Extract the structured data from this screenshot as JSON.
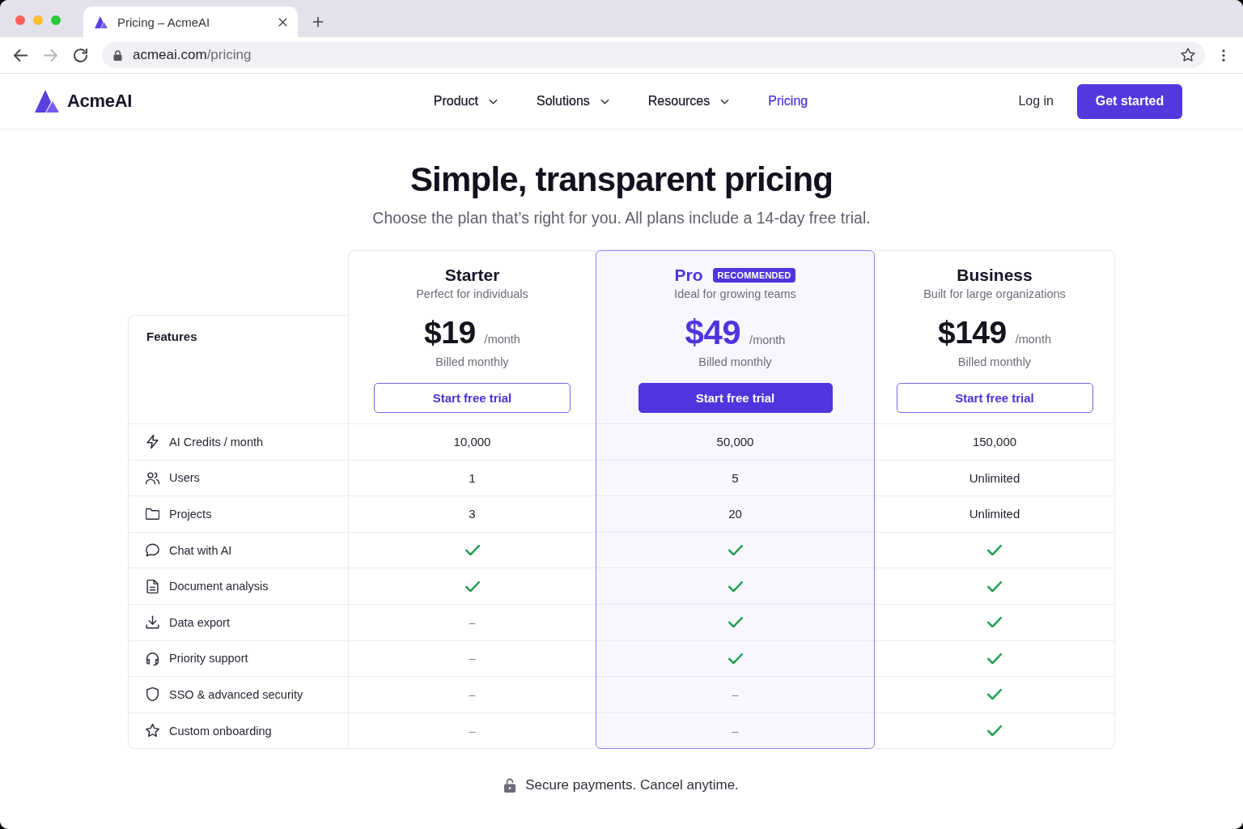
{
  "browser": {
    "tabs": [
      {
        "title": "Pricing – AcmeAI",
        "selected": true
      }
    ],
    "nav_buttons": [
      {
        "kind": "back",
        "disabled": false
      },
      {
        "kind": "forward",
        "disabled": true
      },
      {
        "kind": "reload",
        "disabled": false
      }
    ],
    "url": {
      "host": "acmeai.com",
      "path": "/pricing"
    }
  },
  "site_header": {
    "logo": "AcmeAI",
    "nav": [
      {
        "label": "Product",
        "has_menu": true,
        "selected": false
      },
      {
        "label": "Solutions",
        "has_menu": true,
        "selected": false
      },
      {
        "label": "Resources",
        "has_menu": true,
        "selected": false
      },
      {
        "label": "Pricing",
        "has_menu": false,
        "selected": true
      }
    ],
    "login": "Log in",
    "cta": "Get started"
  },
  "hero": {
    "title": "Simple, transparent pricing",
    "subtitle": "Choose the plan that’s right for you. All plans include a 14-day free trial."
  },
  "pricing_table": {
    "features_heading": "Features",
    "plans": [
      {
        "name": "Starter",
        "subtitle": "Perfect for individuals",
        "price": "$19",
        "period": "/month",
        "billing": "Billed monthly",
        "button": "Start free trial",
        "recommended": false
      },
      {
        "name": "Pro",
        "badge": "RECOMMENDED",
        "subtitle": "Ideal for growing teams",
        "price": "$49",
        "period": "/month",
        "billing": "Billed monthly",
        "button": "Start free trial",
        "recommended": true
      },
      {
        "name": "Business",
        "subtitle": "Built for large organizations",
        "price": "$149",
        "period": "/month",
        "billing": "Billed monthly",
        "button": "Start free trial",
        "recommended": false
      }
    ],
    "rows": [
      {
        "feature": "AI Credits / month",
        "cells": [
          {
            "kind": "text",
            "text": "10,000"
          },
          {
            "kind": "text",
            "text": "50,000"
          },
          {
            "kind": "text",
            "text": "150,000"
          }
        ]
      },
      {
        "feature": "Users",
        "cells": [
          {
            "kind": "text",
            "text": "1"
          },
          {
            "kind": "text",
            "text": "5"
          },
          {
            "kind": "text",
            "text": "Unlimited"
          }
        ]
      },
      {
        "feature": "Projects",
        "cells": [
          {
            "kind": "text",
            "text": "3"
          },
          {
            "kind": "text",
            "text": "20"
          },
          {
            "kind": "text",
            "text": "Unlimited"
          }
        ]
      },
      {
        "feature": "Chat with AI",
        "cells": [
          {
            "kind": "check"
          },
          {
            "kind": "check"
          },
          {
            "kind": "check"
          }
        ]
      },
      {
        "feature": "Document analysis",
        "cells": [
          {
            "kind": "check"
          },
          {
            "kind": "check"
          },
          {
            "kind": "check"
          }
        ]
      },
      {
        "feature": "Data export",
        "cells": [
          {
            "kind": "dash",
            "text": "–"
          },
          {
            "kind": "check"
          },
          {
            "kind": "check"
          }
        ]
      },
      {
        "feature": "Priority support",
        "cells": [
          {
            "kind": "dash",
            "text": "–"
          },
          {
            "kind": "check"
          },
          {
            "kind": "check"
          }
        ]
      },
      {
        "feature": "SSO & advanced security",
        "cells": [
          {
            "kind": "dash",
            "text": "–"
          },
          {
            "kind": "dash",
            "text": "–"
          },
          {
            "kind": "check"
          }
        ]
      },
      {
        "feature": "Custom onboarding",
        "cells": [
          {
            "kind": "dash",
            "text": "–"
          },
          {
            "kind": "dash",
            "text": "–"
          },
          {
            "kind": "check"
          }
        ]
      }
    ]
  },
  "footer_note": "Secure payments. Cancel anytime."
}
